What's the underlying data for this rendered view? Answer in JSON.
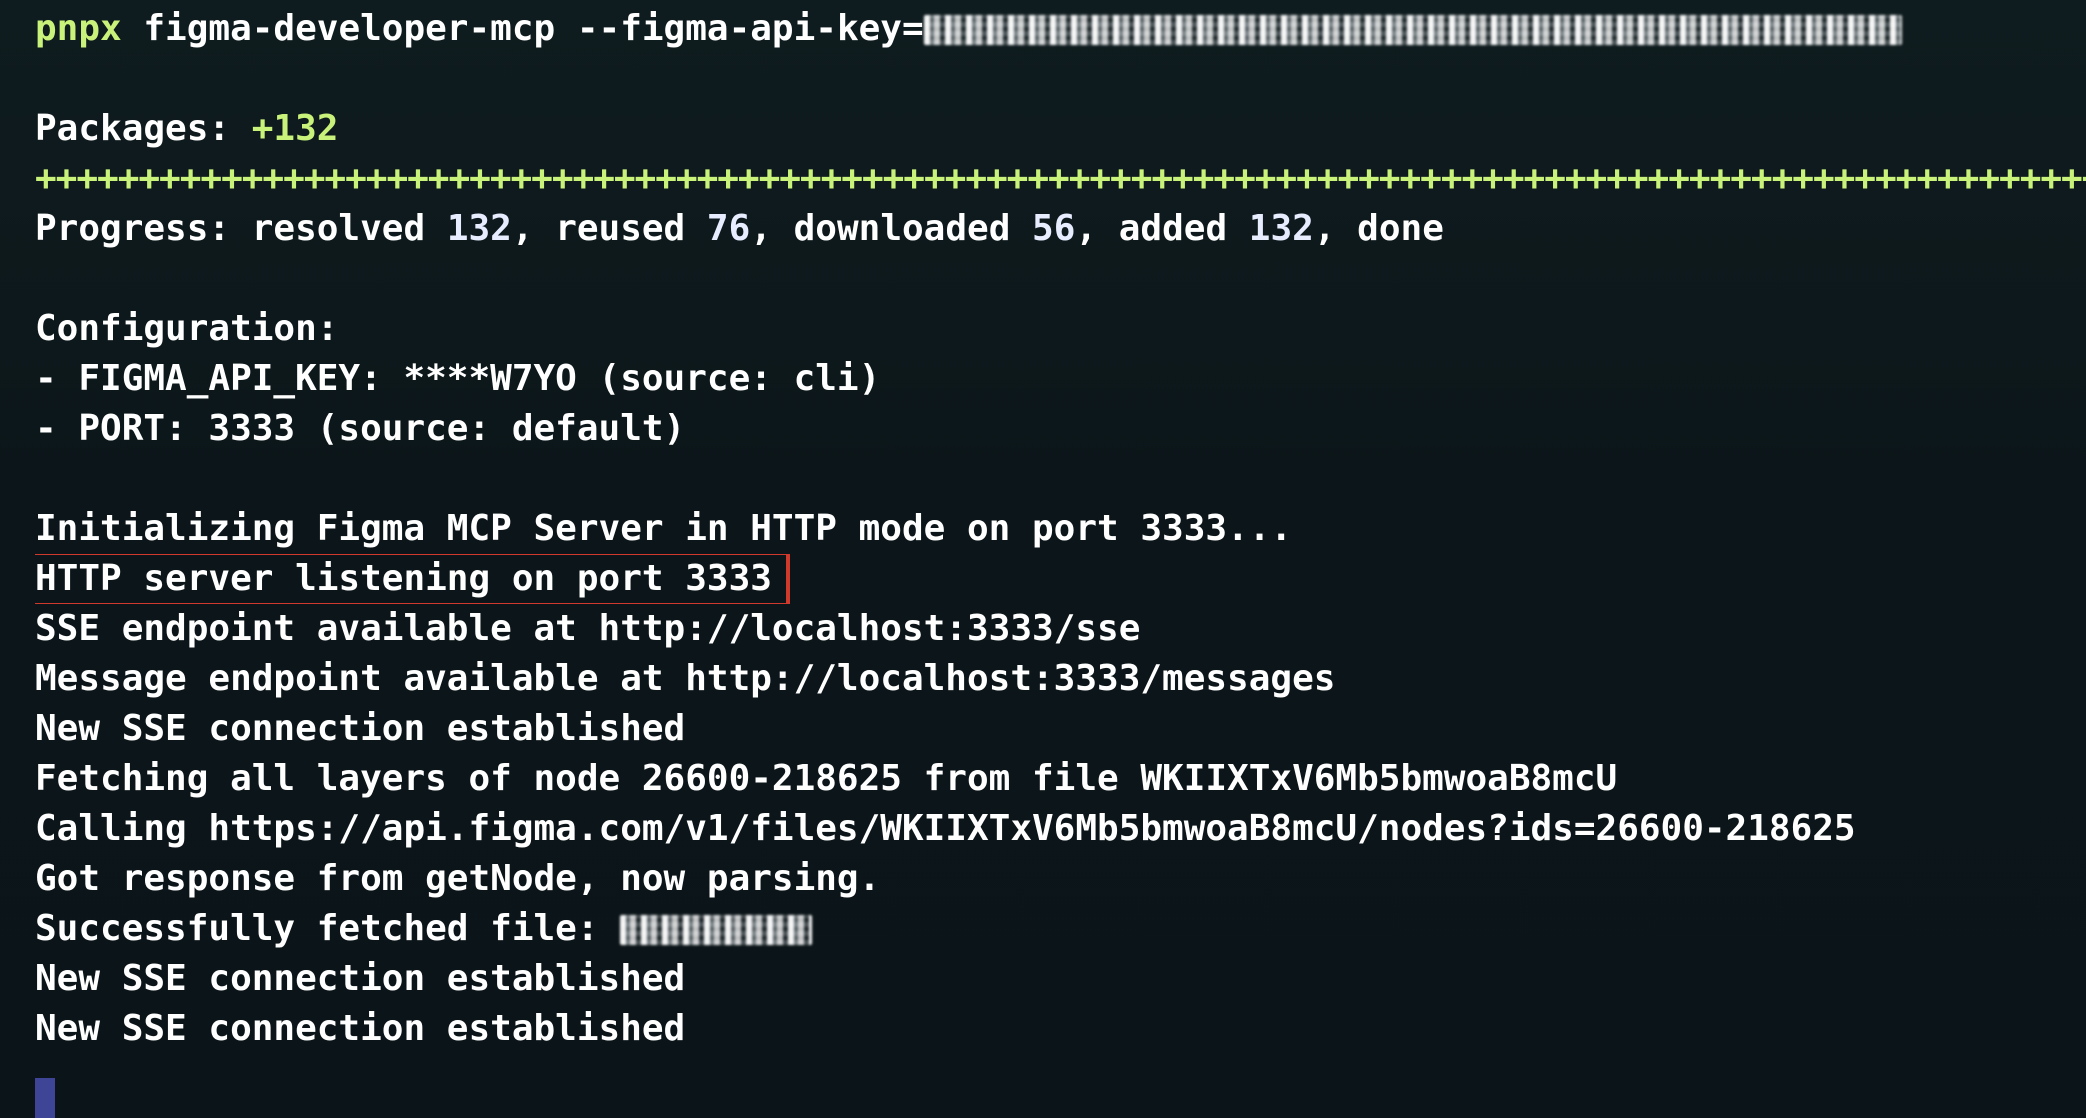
{
  "command": {
    "prefix": "pnpx",
    "text": " figma-developer-mcp --figma-api-key="
  },
  "packages": {
    "label": "Packages: ",
    "count": "+132"
  },
  "progress_bar": "+++++++++++++++++++++++++++++++++++++++++++++++++++++++++++++++++++++++++++++++++++++++++++++++++++++++++++++++++++++++++++++++++++++++++++++++++",
  "progress": {
    "label": "Progress: resolved ",
    "resolved": "132",
    "reused_label": ", reused ",
    "reused": "76",
    "downloaded_label": ", downloaded ",
    "downloaded": "56",
    "added_label": ", added ",
    "added": "132",
    "done_label": ", done"
  },
  "configuration": {
    "heading": "Configuration:",
    "api_key": "- FIGMA_API_KEY: ****W7YO (source: cli)",
    "port": "- PORT: 3333 (source: default)"
  },
  "log": {
    "initializing": "Initializing Figma MCP Server in HTTP mode on port 3333...",
    "http_listening": "HTTP server listening on port 3333",
    "sse_endpoint": "SSE endpoint available at http://localhost:3333/sse",
    "message_endpoint": "Message endpoint available at http://localhost:3333/messages",
    "sse_connection_1": "New SSE connection established",
    "fetching": "Fetching all layers of node 26600-218625 from file WKIIXTxV6Mb5bmwoaB8mcU",
    "calling": "Calling https://api.figma.com/v1/files/WKIIXTxV6Mb5bmwoaB8mcU/nodes?ids=26600-218625",
    "got_response": "Got response from getNode, now parsing.",
    "success_label": "Successfully fetched file: ",
    "sse_connection_2": "New SSE connection established",
    "sse_connection_3": "New SSE connection established"
  },
  "colors": {
    "background": "#0d181c",
    "text": "#ffffff",
    "accent_green": "#c9f27a",
    "highlight_border": "#cf3a2c",
    "cursor": "#3f4596"
  }
}
